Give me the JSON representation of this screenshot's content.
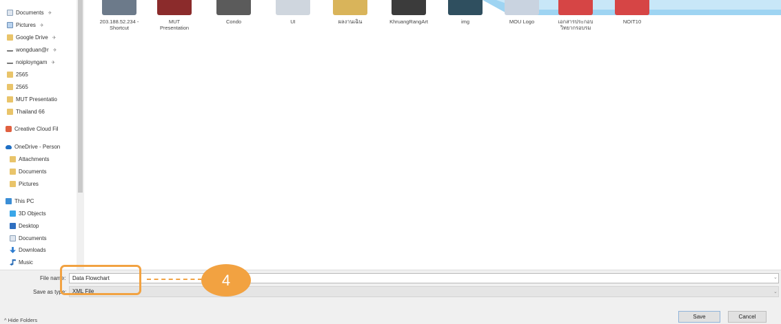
{
  "sidebar": {
    "quick_access": [
      {
        "label": "Documents",
        "icon": "document-folder-icon",
        "pinned": true
      },
      {
        "label": "Pictures",
        "icon": "pictures-folder-icon",
        "pinned": true
      },
      {
        "label": "Google Drive",
        "icon": "folder-icon",
        "pinned": true
      },
      {
        "label": "wongduan@r",
        "icon": "network-drive-icon",
        "pinned": true
      },
      {
        "label": "noiployngam",
        "icon": "network-drive-icon",
        "pinned": true
      },
      {
        "label": "2565",
        "icon": "folder-icon"
      },
      {
        "label": "2565",
        "icon": "folder-icon"
      },
      {
        "label": "MUT Presentatio",
        "icon": "folder-icon"
      },
      {
        "label": "Thailand 66",
        "icon": "folder-icon"
      }
    ],
    "creative_cloud": "Creative Cloud Fil",
    "onedrive": {
      "label": "OneDrive - Person",
      "items": [
        "Attachments",
        "Documents",
        "Pictures"
      ]
    },
    "this_pc": {
      "label": "This PC",
      "items": [
        "3D Objects",
        "Desktop",
        "Documents",
        "Downloads",
        "Music"
      ]
    },
    "pin_glyph": "✈"
  },
  "files": [
    {
      "name": "203.188.52.234 -\nShortcut",
      "color": "#6c7a8a"
    },
    {
      "name": "MUT\nPresentation",
      "color": "#8b2b2b"
    },
    {
      "name": "Condo",
      "color": "#5b5b5b"
    },
    {
      "name": "UI",
      "color": "#cfd6de"
    },
    {
      "name": "ผลงานเฉิน",
      "color": "#d9b45a"
    },
    {
      "name": "KhruangRangArt",
      "color": "#3b3b3b"
    },
    {
      "name": "img",
      "color": "#2f4f5f"
    },
    {
      "name": "MOU Logo",
      "color": "#c9d3e0"
    },
    {
      "name": "เอกสารประกอบ\nวิทยากรอบรม",
      "color": "#d64545"
    },
    {
      "name": "NOIT10",
      "color": "#d64545"
    }
  ],
  "bottom": {
    "file_name_label": "File name:",
    "file_name_value": "Data Flowchart",
    "save_as_type_label": "Save as type:",
    "save_as_type_value": "XML File",
    "hide_folders": "Hide Folders",
    "save": "Save",
    "cancel": "Cancel",
    "chevron": "⌄"
  },
  "callout": {
    "step": "4",
    "color": "#f2a241"
  }
}
